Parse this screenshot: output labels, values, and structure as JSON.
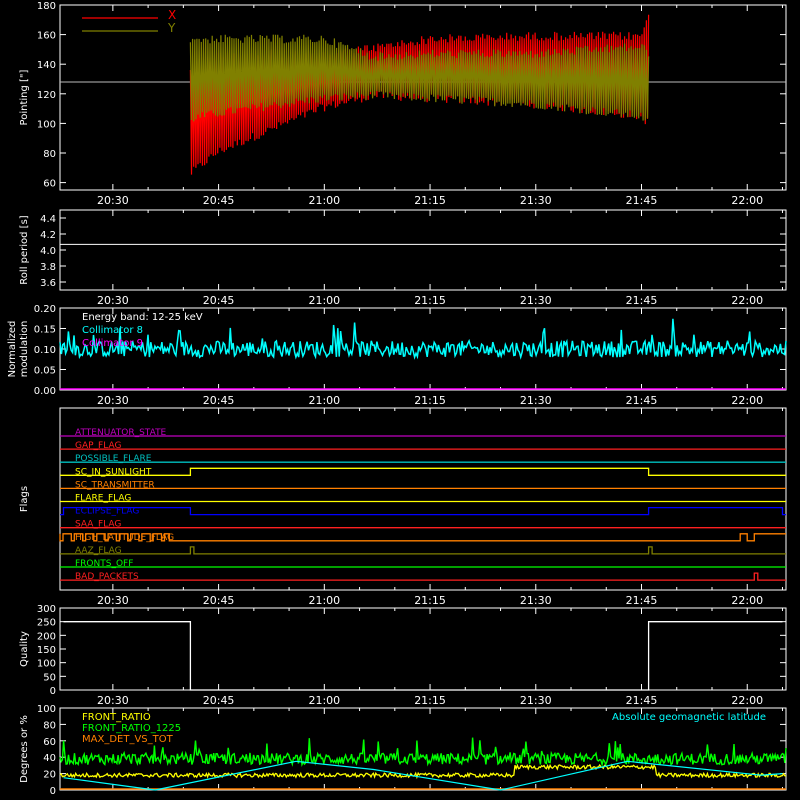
{
  "colors": {
    "background": "#000000",
    "axis": "#ffffff",
    "X": "#ff0000",
    "Y": "#808000",
    "cyan": "#00ffff",
    "magenta": "#ff00ff",
    "yellow": "#ffff00",
    "green": "#00ff00",
    "orange": "#ff8000",
    "blue": "#0000ff",
    "red": "#ff0000",
    "purple": "#c000c0"
  },
  "time_ticks": [
    "20:30",
    "20:45",
    "21:00",
    "21:15",
    "21:30",
    "21:45",
    "22:00"
  ],
  "chart_data": [
    {
      "type": "line",
      "ylabel": "Pointing [\"]",
      "ylim": [
        55,
        180
      ],
      "yticks": [
        "60",
        "80",
        "100",
        "120",
        "140",
        "160",
        "180"
      ],
      "legend_position": "top-left",
      "series": [
        {
          "name": "X",
          "color": "#ff0000",
          "x": [
            "20:41",
            "20:45",
            "21:00",
            "21:07",
            "21:15",
            "21:30",
            "21:45",
            "21:46"
          ],
          "upper": [
            140,
            150,
            150,
            154,
            160,
            162,
            162,
            178
          ],
          "lower": [
            63,
            78,
            108,
            116,
            114,
            110,
            102,
            97
          ]
        },
        {
          "name": "Y",
          "color": "#808000",
          "x": [
            "20:41",
            "20:45",
            "21:00",
            "21:07",
            "21:15",
            "21:30",
            "21:45",
            "21:46"
          ],
          "upper": [
            160,
            160,
            160,
            148,
            150,
            150,
            155,
            150
          ],
          "lower": [
            100,
            104,
            114,
            116,
            114,
            110,
            102,
            97
          ]
        }
      ],
      "reference_line": 128
    },
    {
      "type": "line",
      "ylabel": "Roll period [s]",
      "ylim": [
        3.5,
        4.5
      ],
      "yticks": [
        "3.6",
        "3.8",
        "4.0",
        "4.2",
        "4.4"
      ],
      "series": [
        {
          "name": "",
          "value": 4.07
        }
      ]
    },
    {
      "type": "line",
      "ylabel": "Normalized modulation",
      "ylim": [
        0.0,
        0.2
      ],
      "yticks": [
        "0.00",
        "0.05",
        "0.10",
        "0.15",
        "0.20"
      ],
      "annotation": "Energy band: 12-25 keV",
      "series": [
        {
          "name": "Collimator 8",
          "color": "#00ffff",
          "mean": 0.1,
          "spread": 0.02
        },
        {
          "name": "Collimator 9",
          "color": "#ff00ff",
          "value": 0.0
        }
      ]
    },
    {
      "type": "line",
      "ylabel": "Flags",
      "flags": [
        {
          "name": "ATTENUATOR_STATE",
          "color": "#c000c0",
          "segments": []
        },
        {
          "name": "GAP_FLAG",
          "color": "#ff2020",
          "segments": []
        },
        {
          "name": "POSSIBLE_FLARE",
          "color": "#00c0c0",
          "segments": []
        },
        {
          "name": "SC_IN_SUNLIGHT",
          "color": "#ffff00",
          "segments": [
            [
              "20:41",
              "21:46"
            ]
          ]
        },
        {
          "name": "SC_TRANSMITTER",
          "color": "#ff8000",
          "segments": []
        },
        {
          "name": "FLARE_FLAG",
          "color": "#ffff00",
          "segments": []
        },
        {
          "name": "ECLIPSE_FLAG",
          "color": "#0000ff",
          "segments": [
            [
              "20:23",
              "20:41"
            ],
            [
              "21:46",
              "22:05"
            ]
          ]
        },
        {
          "name": "SAA_FLAG",
          "color": "#ff2020",
          "segments": []
        },
        {
          "name": "HIGH_LATITUDE_FLAG",
          "color": "#ff8000",
          "segments": [
            [
              "20:23",
              "20:38"
            ],
            [
              "21:59",
              "22:01"
            ]
          ]
        },
        {
          "name": "AAZ_FLAG",
          "color": "#808000",
          "segments": [
            [
              "20:41",
              "20:41.5"
            ],
            [
              "21:46",
              "21:46.5"
            ]
          ]
        },
        {
          "name": "FRONTS_OFF",
          "color": "#00ff00",
          "segments": []
        },
        {
          "name": "BAD_PACKETS",
          "color": "#ff2020",
          "segments": [
            [
              "22:01",
              "22:01.5"
            ]
          ]
        }
      ]
    },
    {
      "type": "line",
      "ylabel": "Quality",
      "ylim": [
        0,
        300
      ],
      "yticks": [
        "0",
        "50",
        "100",
        "150",
        "200",
        "250",
        "300"
      ],
      "series": [
        {
          "name": "",
          "color": "#ffffff",
          "x": [
            "20:23",
            "20:41",
            "20:41",
            "21:46",
            "21:46",
            "22:05"
          ],
          "y": [
            250,
            250,
            0,
            0,
            250,
            250
          ]
        }
      ]
    },
    {
      "type": "line",
      "ylabel": "Degrees or %",
      "ylim": [
        0,
        100
      ],
      "yticks": [
        "0",
        "20",
        "40",
        "60",
        "80",
        "100"
      ],
      "legend_right": "Absolute geomagnetic latitude",
      "series": [
        {
          "name": "FRONT_RATIO",
          "color": "#ffff00",
          "mean": 18
        },
        {
          "name": "FRONT_RATIO_1225",
          "color": "#00ff00",
          "mean": 38
        },
        {
          "name": "MAX_DET_VS_TOT",
          "color": "#ff8000",
          "value": 0
        },
        {
          "name": "Absolute geomagnetic latitude",
          "color": "#00ffff",
          "x": [
            "20:23",
            "20:36",
            "20:56",
            "21:07",
            "21:25",
            "21:43",
            "22:02",
            "22:05"
          ],
          "y": [
            15,
            0,
            35,
            25,
            0,
            35,
            18,
            20
          ]
        }
      ]
    }
  ]
}
